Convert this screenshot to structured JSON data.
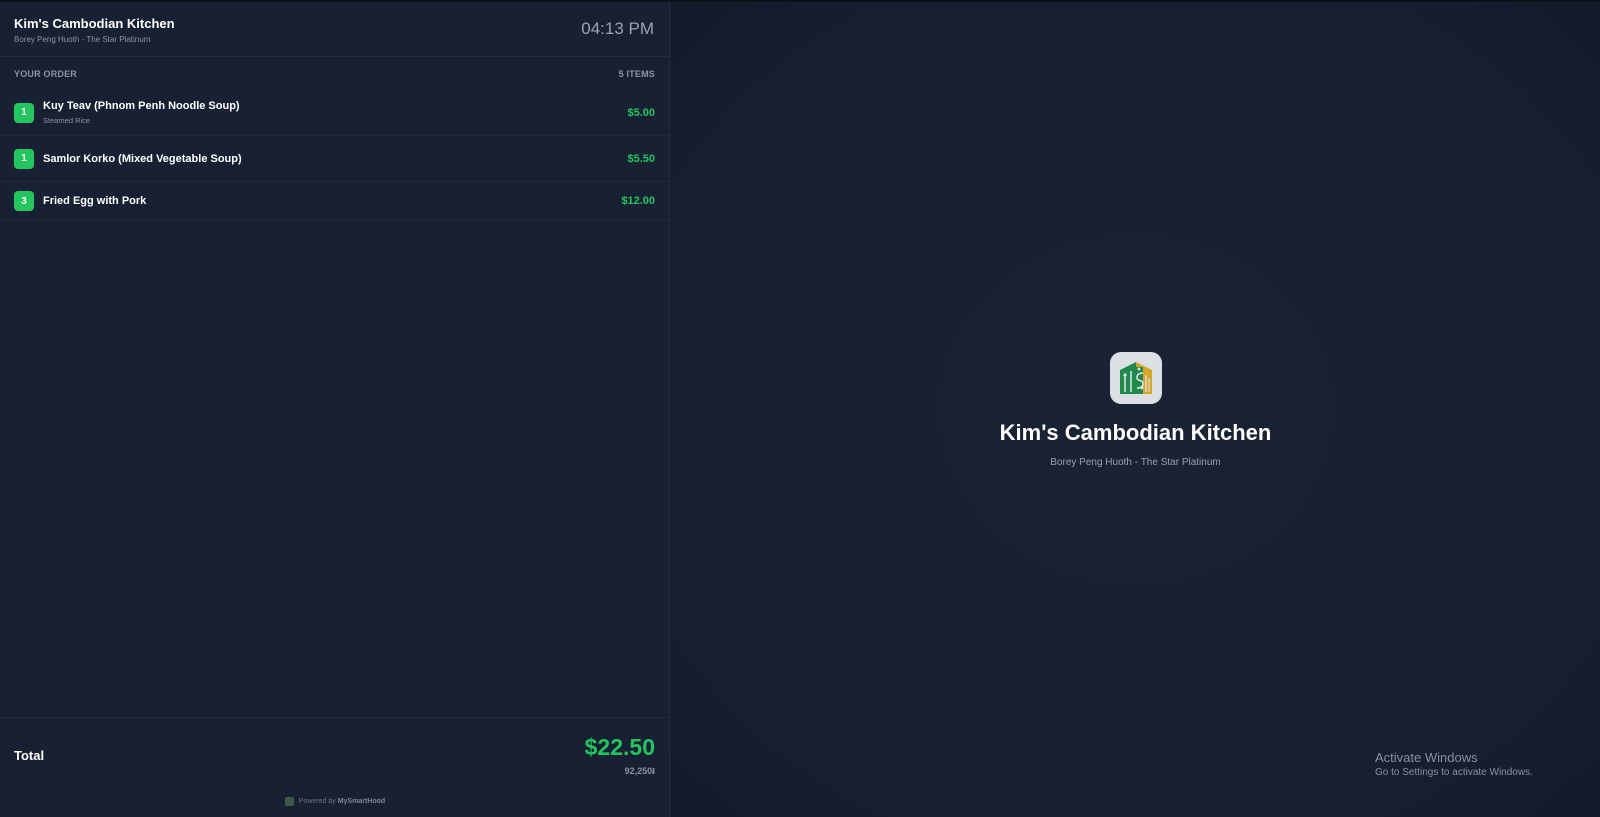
{
  "restaurant": {
    "name": "Kim's Cambodian Kitchen",
    "location": "Borey Peng Huoth - The Star Platinum"
  },
  "clock": "04:13 PM",
  "order": {
    "heading": "YOUR ORDER",
    "count_label": "5 ITEMS",
    "items": [
      {
        "qty": "1",
        "name": "Kuy Teav (Phnom Penh Noodle Soup)",
        "modifier": "Steamed Rice",
        "price": "$5.00"
      },
      {
        "qty": "1",
        "name": "Samlor Korko (Mixed Vegetable Soup)",
        "modifier": "",
        "price": "$5.50"
      },
      {
        "qty": "3",
        "name": "Fried Egg with Pork",
        "modifier": "",
        "price": "$12.00"
      }
    ]
  },
  "total": {
    "label": "Total",
    "amount": "$22.50",
    "riel": "92,250៛"
  },
  "footer": {
    "powered_prefix": "Powered by",
    "powered_brand": "MySmartHood"
  },
  "display": {
    "logo_icon": "mysmarthood-building-logo",
    "brand_name": "Kim's Cambodian Kitchen",
    "brand_location": "Borey Peng Huoth - The Star Platinum"
  },
  "watermark": {
    "title": "Activate Windows",
    "subtitle": "Go to Settings to activate Windows."
  },
  "colors": {
    "accent_green": "#22c55e",
    "panel_bg": "#182034",
    "page_bg": "#161d2e",
    "logo_green": "#1f8a4c",
    "logo_gold": "#d4a628"
  }
}
